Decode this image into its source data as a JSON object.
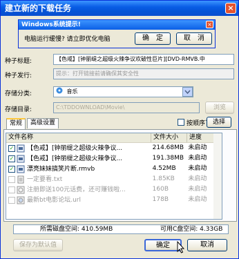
{
  "window": {
    "title": "建立新的下载任务",
    "close": "×"
  },
  "popup": {
    "title": "Windows系统提示!",
    "message": "电脑运行缓慢? 请立即优化电脑",
    "ok": "确　定",
    "cancel": "取　消",
    "close": "×"
  },
  "form": {
    "seed_title_label": "种子标题:",
    "seed_title_value": "【色戒】[钟丽缇之超级火辣争议欢破性巨片][DVD-RMVB.中",
    "seed_publish_label": "种子发行:",
    "seed_publish_value": "提示：打开链接前请确保其安全性",
    "category_label": "存储分类:",
    "category_value": "音乐",
    "dir_label": "存储目录:",
    "dir_value": "C:\\TDDOWNLOAD\\Movie\\",
    "browse": "浏览"
  },
  "tabs": [
    {
      "label": "常规"
    },
    {
      "label": "高级设置"
    }
  ],
  "order_download": "按顺序下载",
  "select": "选择",
  "columns": {
    "name": "文件名称",
    "size": "文件大小",
    "progress": "进度"
  },
  "files": [
    {
      "name": "【色戒】[钟丽缇之超级火辣争议...",
      "size": "214.68MB",
      "progress": "未启动",
      "checked": true
    },
    {
      "name": "【色戒】[钟丽缇之超级火辣争议...",
      "size": "191.38MB",
      "progress": "未启动",
      "checked": true
    },
    {
      "name": "漂亮妹妹搞笑片断.rmvb",
      "size": "4.52MB",
      "progress": "未启动",
      "checked": true
    },
    {
      "name": "一定要看.txt",
      "size": "1.85KB",
      "progress": "未启动",
      "checked": false
    },
    {
      "name": "注册即送100元话费，还可赚钱啦...",
      "size": "160B",
      "progress": "未启动",
      "checked": false
    },
    {
      "name": "最新bt电影论坛.url",
      "size": "178B",
      "progress": "未启动",
      "checked": false
    }
  ],
  "status": {
    "needed": "所需磁盘空间: 410.59MB",
    "available": "可用C盘空间: 4.33GB"
  },
  "buttons": {
    "save_default": "保存为默认值",
    "ok": "确定",
    "cancel": "取消"
  },
  "colors": {
    "title_blue": "#0a5ee6",
    "face": "#ece9d8",
    "close_red": "#e3532f"
  }
}
